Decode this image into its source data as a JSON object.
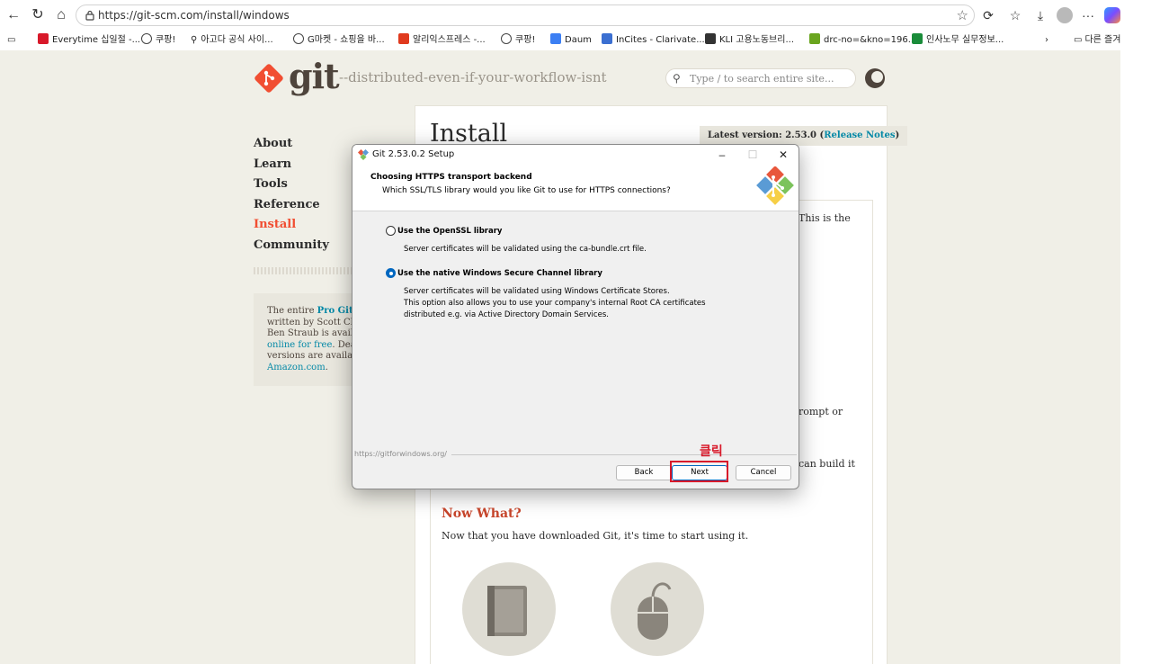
{
  "browser": {
    "url": "https://git-scm.com/install/windows",
    "bookmarks": [
      {
        "label": "Everytime 십일절 -...",
        "color": "#d8192a"
      },
      {
        "label": "쿠팡!",
        "color": "globe"
      },
      {
        "label": "아고다 공식 사이...",
        "color": "search"
      },
      {
        "label": "G마켓 - 쇼핑을 바...",
        "color": "globe"
      },
      {
        "label": "알리익스프레스 -...",
        "color": "#e03a1e"
      },
      {
        "label": "쿠팡!",
        "color": "globe"
      },
      {
        "label": "Daum",
        "color": "#3c7ff3"
      },
      {
        "label": "InCites - Clarivate...",
        "color": "#3b6fd1"
      },
      {
        "label": "KLI 고용노동브리...",
        "color": "#333333"
      },
      {
        "label": "drc-no=&kno=196...",
        "color": "#6aa51f"
      },
      {
        "label": "인사노무 실무정보...",
        "color": "#1a8c3a"
      }
    ],
    "other_favorites": "다른 즐겨"
  },
  "site": {
    "logo_text": "git",
    "tagline": "--distributed-even-if-your-workflow-isnt",
    "search_placeholder": "Type / to search entire site...",
    "nav": [
      "About",
      "Learn",
      "Tools",
      "Reference",
      "Install",
      "Community"
    ],
    "active_nav": "Install",
    "probook": {
      "line1_pre": "The entire ",
      "line1_link": "Pro Git bo",
      "line2": "written by Scott Chaco",
      "line3": "Ben Straub is available",
      "line4_link": "online for free",
      "line4_post": ". Dead t",
      "line5": "versions are available",
      "line6_link": "Amazon.com",
      "line6_post": "."
    },
    "page_title": "Install",
    "latest_label": "Latest version: ",
    "latest_version": "2.53.0",
    "release_notes": "Release Notes",
    "fragments": {
      "this_is_the": "This is the",
      "prompt_or": "rompt or",
      "can_build_it": "can build it"
    },
    "now_what_heading": "Now What?",
    "now_what_text": "Now that you have downloaded Git, it's time to start using it."
  },
  "dialog": {
    "title": "Git 2.53.0.2 Setup",
    "heading": "Choosing HTTPS transport backend",
    "subheading": "Which SSL/TLS library would you like Git to use for HTTPS connections?",
    "options": [
      {
        "label": "Use the OpenSSL library",
        "selected": false,
        "desc": [
          "Server certificates will be validated using the ca-bundle.crt file."
        ]
      },
      {
        "label": "Use the native Windows Secure Channel library",
        "selected": true,
        "desc": [
          "Server certificates will be validated using Windows Certificate Stores.",
          "This option also allows you to use your company's internal Root CA certificates",
          "distributed e.g. via Active Directory Domain Services."
        ]
      }
    ],
    "footer_url": "https://gitforwindows.org/",
    "buttons": {
      "back": "Back",
      "next": "Next",
      "cancel": "Cancel"
    }
  },
  "annotation": {
    "click_label": "클릭",
    "color": "#d8192a"
  }
}
